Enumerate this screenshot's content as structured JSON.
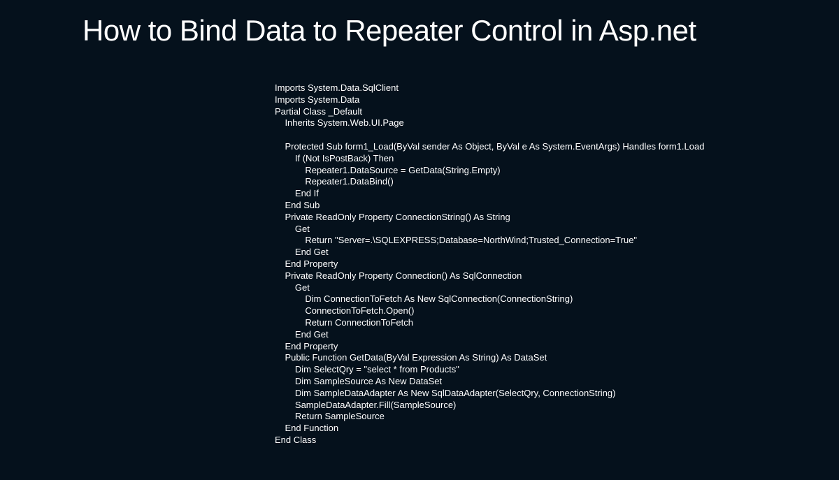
{
  "title": "How to Bind Data to Repeater Control in Asp.net",
  "code": "Imports System.Data.SqlClient\nImports System.Data\nPartial Class _Default\n    Inherits System.Web.UI.Page\n\n    Protected Sub form1_Load(ByVal sender As Object, ByVal e As System.EventArgs) Handles form1.Load\n        If (Not IsPostBack) Then\n            Repeater1.DataSource = GetData(String.Empty)\n            Repeater1.DataBind()\n        End If\n    End Sub\n    Private ReadOnly Property ConnectionString() As String\n        Get\n            Return \"Server=.\\SQLEXPRESS;Database=NorthWind;Trusted_Connection=True\"\n        End Get\n    End Property\n    Private ReadOnly Property Connection() As SqlConnection\n        Get\n            Dim ConnectionToFetch As New SqlConnection(ConnectionString)\n            ConnectionToFetch.Open()\n            Return ConnectionToFetch\n        End Get\n    End Property\n    Public Function GetData(ByVal Expression As String) As DataSet\n        Dim SelectQry = \"select * from Products\"\n        Dim SampleSource As New DataSet\n        Dim SampleDataAdapter As New SqlDataAdapter(SelectQry, ConnectionString)\n        SampleDataAdapter.Fill(SampleSource)\n        Return SampleSource\n    End Function\nEnd Class"
}
